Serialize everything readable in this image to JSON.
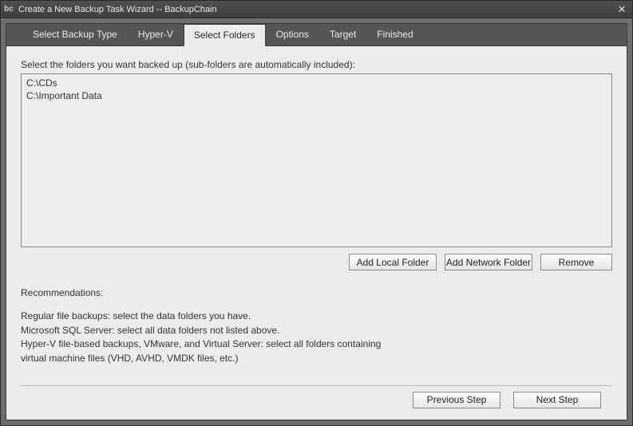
{
  "titlebar": {
    "icon_text": "bc",
    "title": "Create a New Backup Task Wizard -- BackupChain"
  },
  "tabs": [
    {
      "label": "Select Backup Type",
      "active": false
    },
    {
      "label": "Hyper-V",
      "active": false
    },
    {
      "label": "Select Folders",
      "active": true
    },
    {
      "label": "Options",
      "active": false
    },
    {
      "label": "Target",
      "active": false
    },
    {
      "label": "Finished",
      "active": false
    }
  ],
  "content": {
    "instruction": "Select the folders you want backed up (sub-folders are automatically included):",
    "folders": [
      "C:\\CDs",
      "C:\\Important Data"
    ],
    "buttons": {
      "add_local": "Add Local Folder",
      "add_network": "Add Network Folder",
      "remove": "Remove"
    },
    "recommendations": {
      "heading": "Recommendations:",
      "lines": [
        "Regular file backups: select the data folders you have.",
        "Microsoft SQL Server: select all data folders not listed above.",
        "Hyper-V file-based backups, VMware, and Virtual Server: select all folders containing",
        "virtual machine files (VHD, AVHD, VMDK files, etc.)"
      ]
    }
  },
  "footer": {
    "previous": "Previous Step",
    "next": "Next Step"
  }
}
